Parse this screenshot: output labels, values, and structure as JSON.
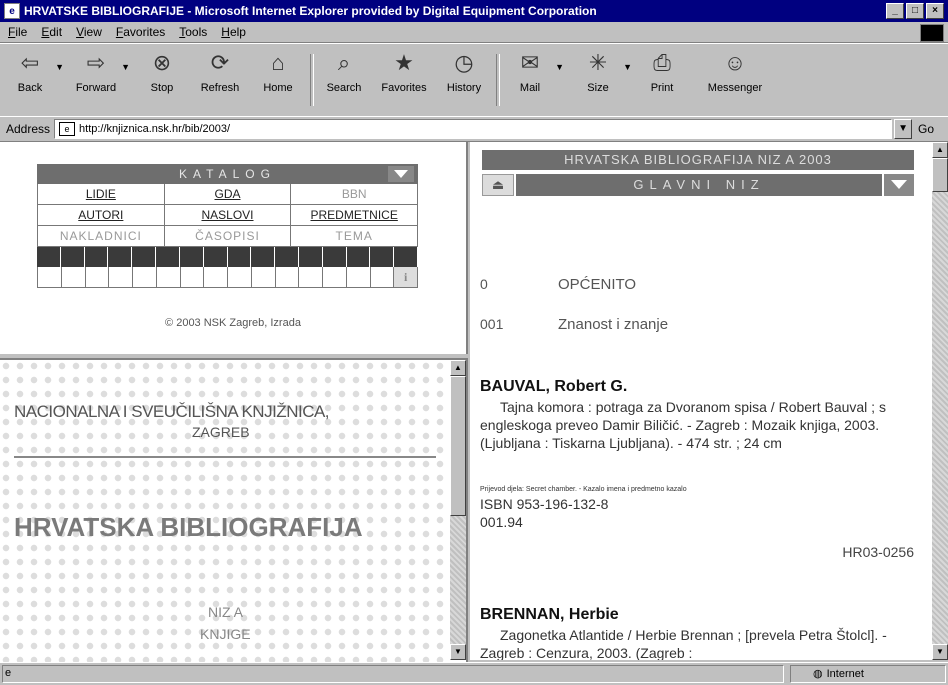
{
  "window": {
    "title": "HRVATSKE BIBLIOGRAFIJE - Microsoft Internet Explorer provided by Digital Equipment Corporation",
    "controls": [
      "_",
      "□",
      "×"
    ]
  },
  "menu": [
    "File",
    "Edit",
    "View",
    "Favorites",
    "Tools",
    "Help"
  ],
  "toolbar": {
    "back": "Back",
    "forward": "Forward",
    "stop": "Stop",
    "refresh": "Refresh",
    "home": "Home",
    "search": "Search",
    "favorites": "Favorites",
    "history": "History",
    "mail": "Mail",
    "size": "Size",
    "print": "Print",
    "messenger": "Messenger"
  },
  "address": {
    "label": "Address",
    "value": "http://knjiznica.nsk.hr/bib/2003/",
    "go": "Go"
  },
  "katalog": {
    "header": "KATALOG",
    "row1": [
      "LIDIE",
      "GDA",
      "BBN"
    ],
    "row2": [
      "AUTORI",
      "NASLOVI",
      "PREDMETNICE"
    ],
    "row3": [
      "NAKLADNICI",
      "ČASOPISI",
      "TEMA"
    ],
    "info_icon": "i",
    "copyright": "© 2003 NSK Zagreb, Izrada"
  },
  "logo_panel": {
    "line1": "NACIONALNA I SVEUČILIŠNA KNJIŽNICA,",
    "line2": "ZAGREB",
    "title": "HRVATSKA BIBLIOGRAFIJA",
    "niza1": "NIZ A",
    "niza2": "KNJIGE"
  },
  "right": {
    "header1": "HRVATSKA BIBLIOGRAFIJA NIZ A 2003",
    "header2": "GLAVNI NIZ",
    "section0_num": "0",
    "section0_name": "OPĆENITO",
    "section001_num": "001",
    "section001_name": "Znanost i znanje",
    "entry1_name": "BAUVAL, Robert G.",
    "entry1_text": "Tajna komora : potraga za Dvoranom spisa / Robert Bauval ; s engleskoga preveo Damir Biličić. - Zagreb : Mozaik knjiga, 2003. (Ljubljana : Tiskarna Ljubljana). - 474 str. ; 24 cm",
    "entry1_note": "Prijevod djela: Secret chamber. - Kazalo imena i predmetno kazalo",
    "entry1_isbn": "ISBN 953-196-132-8",
    "entry1_udc": "001.94",
    "entry1_sig": "HR03-0256",
    "entry2_name": "BRENNAN, Herbie",
    "entry2_text": "Zagonetka Atlantide / Herbie Brennan ; [prevela Petra Štolcl]. - Zagreb : Cenzura, 2003. (Zagreb :"
  },
  "status": {
    "zone": "Internet"
  }
}
